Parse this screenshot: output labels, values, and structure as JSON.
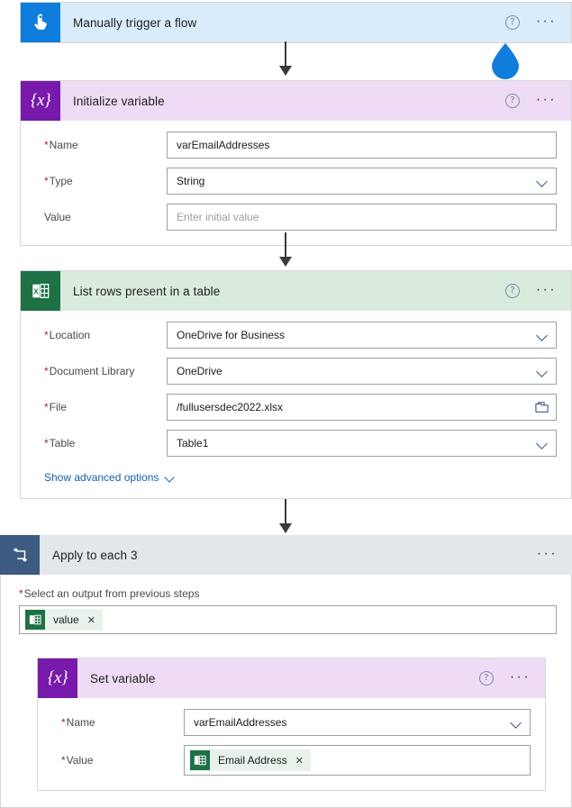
{
  "app": {
    "name": "Power Automate flow designer"
  },
  "colors": {
    "trigger_header": "#d9ecfb",
    "trigger_icon": "#0f7ddb",
    "variable_header": "#eedcf6",
    "variable_icon": "#7719aa",
    "excel_header": "#d8ebdd",
    "excel_icon": "#1e7145",
    "loop_header": "#e2e7ec",
    "loop_icon": "#3d5a80",
    "required_asterisk": "#a4262c",
    "link": "#1560a8",
    "cursor_droplet": "#0f7ddb"
  },
  "cards": {
    "trigger": {
      "title": "Manually trigger a flow",
      "icon": "touch-hand-icon",
      "help_label": "?",
      "menu_label": "···"
    },
    "initialize_variable": {
      "title": "Initialize variable",
      "icon": "variable-braces-icon",
      "help_label": "?",
      "menu_label": "···",
      "fields": [
        {
          "label": "Name",
          "required": true,
          "value": "varEmailAddresses",
          "placeholder": "",
          "control": "text"
        },
        {
          "label": "Type",
          "required": true,
          "value": "String",
          "placeholder": "",
          "control": "dropdown"
        },
        {
          "label": "Value",
          "required": false,
          "value": "",
          "placeholder": "Enter initial value",
          "control": "text"
        }
      ]
    },
    "list_rows": {
      "title": "List rows present in a table",
      "icon": "excel-icon",
      "help_label": "?",
      "menu_label": "···",
      "fields": [
        {
          "label": "Location",
          "required": true,
          "value": "OneDrive for Business",
          "placeholder": "",
          "control": "dropdown"
        },
        {
          "label": "Document Library",
          "required": true,
          "value": "OneDrive",
          "placeholder": "",
          "control": "dropdown"
        },
        {
          "label": "File",
          "required": true,
          "value": "/fullusersdec2022.xlsx",
          "placeholder": "",
          "control": "filepicker"
        },
        {
          "label": "Table",
          "required": true,
          "value": "Table1",
          "placeholder": "",
          "control": "dropdown"
        }
      ],
      "advanced_options_label": "Show advanced options"
    },
    "apply_to_each": {
      "title": "Apply to each 3",
      "icon": "loop-icon",
      "menu_label": "···",
      "output_label": "Select an output from previous steps",
      "output_required": true,
      "token": {
        "text": "value",
        "icon": "excel-token-icon",
        "remove_label": "✕"
      }
    },
    "set_variable": {
      "title": "Set variable",
      "icon": "variable-braces-icon",
      "help_label": "?",
      "menu_label": "···",
      "fields": [
        {
          "label": "Name",
          "required": true,
          "value": "varEmailAddresses",
          "control": "dropdown"
        },
        {
          "label": "Value",
          "required": true,
          "control": "token"
        }
      ],
      "value_token": {
        "text": "Email Address",
        "icon": "excel-token-icon",
        "remove_label": "✕"
      }
    }
  }
}
